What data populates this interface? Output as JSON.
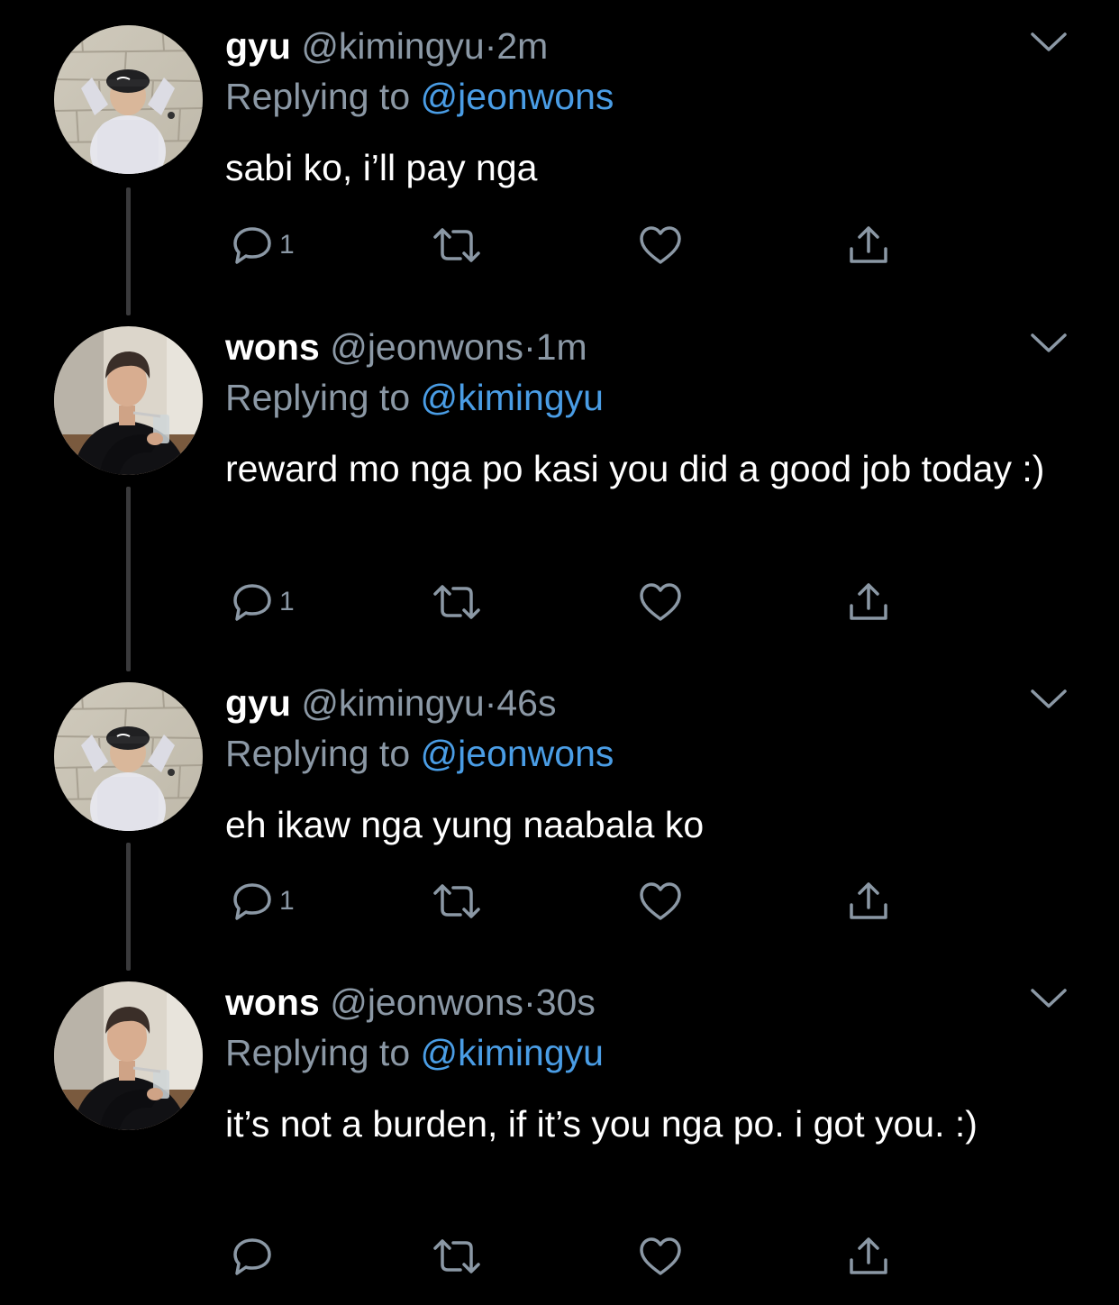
{
  "tweets": [
    {
      "name": "gyu",
      "handle": "@kimingyu",
      "time": "2m",
      "replying_label": "Replying to",
      "replying_to": "@jeonwons",
      "text": "sabi ko, i’ll pay nga",
      "reply_count": "1"
    },
    {
      "name": "wons",
      "handle": "@jeonwons",
      "time": "1m",
      "replying_label": "Replying to",
      "replying_to": "@kimingyu",
      "text": "reward mo nga po kasi you did a good job today :)",
      "reply_count": "1"
    },
    {
      "name": "gyu",
      "handle": "@kimingyu",
      "time": "46s",
      "replying_label": "Replying to",
      "replying_to": "@jeonwons",
      "text": "eh ikaw nga yung naabala ko",
      "reply_count": "1"
    },
    {
      "name": "wons",
      "handle": "@jeonwons",
      "time": "30s",
      "replying_label": "Replying to",
      "replying_to": "@kimingyu",
      "text": "it’s not a burden, if it’s you nga po. i got you. :)",
      "reply_count": ""
    }
  ],
  "meta_separator": "·",
  "icons": {
    "reply": "reply-icon",
    "retweet": "retweet-icon",
    "like": "heart-icon",
    "share": "share-icon",
    "more": "chevron-down-icon"
  },
  "colors": {
    "background": "#000000",
    "text_primary": "#ffffff",
    "text_secondary": "#8b98a5",
    "mention": "#4a9de5",
    "thread_line": "#3a3a3c"
  }
}
